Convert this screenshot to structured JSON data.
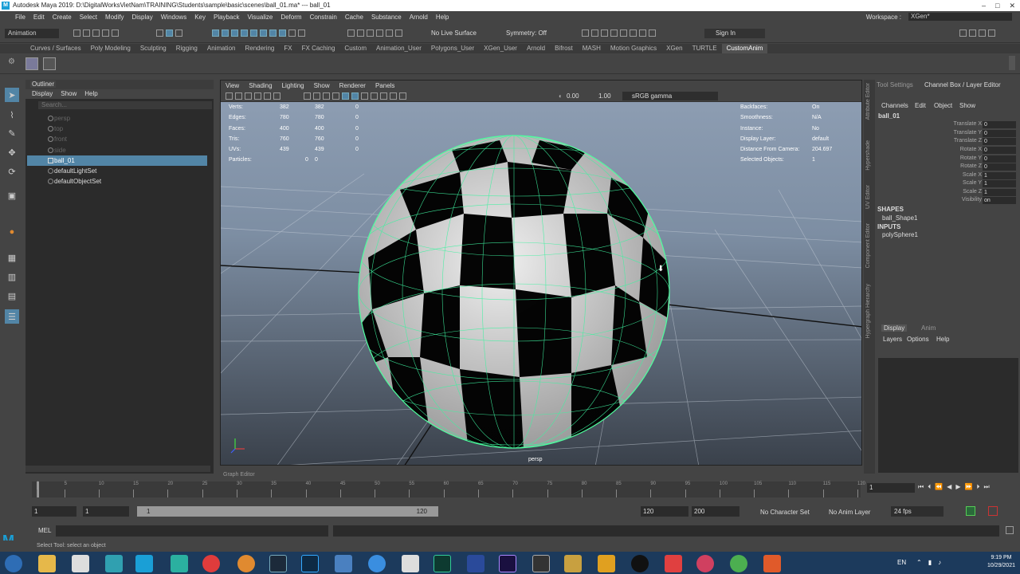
{
  "window": {
    "title": "Autodesk Maya 2019: D:\\DigitalWorksVietNam\\TRAINING\\Students\\sample\\basic\\scenes\\ball_01.ma*   ---   ball_01",
    "minimize": "–",
    "maximize": "□",
    "close": "✕"
  },
  "menubar": {
    "items": [
      "File",
      "Edit",
      "Create",
      "Select",
      "Modify",
      "Display",
      "Windows",
      "Key",
      "Playback",
      "Visualize",
      "Deform",
      "Constrain",
      "Cache",
      "Substance",
      "Arnold",
      "Help"
    ],
    "workspace_label": "Workspace :",
    "workspace_value": "XGen*"
  },
  "statusline": {
    "mode": "Animation",
    "live_surface": "No Live Surface",
    "symmetry": "Symmetry: Off",
    "sign_in": "Sign In"
  },
  "shelf": {
    "tabs": [
      "Curves / Surfaces",
      "Poly Modeling",
      "Sculpting",
      "Rigging",
      "Animation",
      "Rendering",
      "FX",
      "FX Caching",
      "Custom",
      "Animation_User",
      "Polygons_User",
      "XGen_User",
      "Arnold",
      "Bifrost",
      "MASH",
      "Motion Graphics",
      "XGen",
      "TURTLE",
      "CustomAnim"
    ],
    "active_tab": "CustomAnim"
  },
  "outliner": {
    "title": "Outliner",
    "menu": [
      "Display",
      "Show",
      "Help"
    ],
    "search_placeholder": "Search...",
    "items": [
      {
        "label": "persp",
        "state": "dim"
      },
      {
        "label": "top",
        "state": "dim"
      },
      {
        "label": "front",
        "state": "dim"
      },
      {
        "label": "side",
        "state": "dim"
      },
      {
        "label": "ball_01",
        "state": "sel"
      },
      {
        "label": "defaultLightSet",
        "state": "normal"
      },
      {
        "label": "defaultObjectSet",
        "state": "normal"
      }
    ]
  },
  "viewport": {
    "menu": [
      "View",
      "Shading",
      "Lighting",
      "Show",
      "Renderer",
      "Panels"
    ],
    "exposure": "0.00",
    "gamma": "1.00",
    "colorspace": "sRGB gamma",
    "camera_label": "persp",
    "hud_left": {
      "labels": [
        "Verts:",
        "Edges:",
        "Faces:",
        "Tris:",
        "UVs:",
        "Particles:"
      ],
      "col1": [
        "382",
        "780",
        "400",
        "760",
        "439",
        ""
      ],
      "col2": [
        "382",
        "780",
        "400",
        "760",
        "439",
        "0"
      ],
      "col3": [
        "0",
        "0",
        "0",
        "0",
        "0",
        "0"
      ]
    },
    "hud_right": {
      "labels": [
        "Backfaces:",
        "Smoothness:",
        "Instance:",
        "Display Layer:",
        "Distance From Camera:",
        "Selected Objects:"
      ],
      "values": [
        "On",
        "N/A",
        "No",
        "default",
        "204.697",
        "1"
      ]
    }
  },
  "channelbox": {
    "tabs": [
      "Tool Settings",
      "Channel Box / Layer Editor"
    ],
    "menu": [
      "Channels",
      "Edit",
      "Object",
      "Show"
    ],
    "object": "ball_01",
    "attrs": [
      {
        "name": "Translate X",
        "value": "0"
      },
      {
        "name": "Translate Y",
        "value": "0"
      },
      {
        "name": "Translate Z",
        "value": "0"
      },
      {
        "name": "Rotate X",
        "value": "0"
      },
      {
        "name": "Rotate Y",
        "value": "0"
      },
      {
        "name": "Rotate Z",
        "value": "0"
      },
      {
        "name": "Scale X",
        "value": "1"
      },
      {
        "name": "Scale Y",
        "value": "1"
      },
      {
        "name": "Scale Z",
        "value": "1"
      },
      {
        "name": "Visibility",
        "value": "on"
      }
    ],
    "shapes_header": "SHAPES",
    "shape": "ball_Shape1",
    "inputs_header": "INPUTS",
    "input": "polySphere1"
  },
  "side_tabs": [
    "Attribute Editor",
    "Hypershade",
    "UV Editor",
    "Component Editor",
    "Hypergraph Hierarchy"
  ],
  "layer_editor": {
    "tabs": [
      "Display",
      "Anim"
    ],
    "menu": [
      "Layers",
      "Options",
      "Help"
    ]
  },
  "timeline": {
    "graph_editor_label": "Graph Editor",
    "ticks": [
      "1",
      "5",
      "10",
      "15",
      "20",
      "25",
      "30",
      "35",
      "40",
      "45",
      "50",
      "55",
      "60",
      "65",
      "70",
      "75",
      "80",
      "85",
      "90",
      "95",
      "100",
      "105",
      "110",
      "115",
      "120"
    ],
    "current_frame": "1",
    "range_start": "1",
    "range_start2": "1",
    "slider_start": "1",
    "slider_end": "120",
    "range_end": "120",
    "anim_end": "200",
    "character_set": "No Character Set",
    "anim_layer": "No Anim Layer",
    "fps": "24 fps"
  },
  "cmdline": {
    "label": "MEL"
  },
  "helpline": {
    "text": "Select Tool: select an object"
  },
  "taskbar": {
    "lang": "EN",
    "time": "9:19 PM",
    "date": "10/29/2021"
  }
}
